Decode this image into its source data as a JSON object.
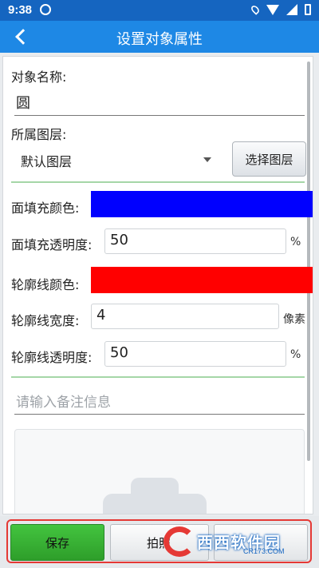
{
  "status_bar": {
    "time": "9:38"
  },
  "header": {
    "title": "设置对象属性"
  },
  "form": {
    "object_name_label": "对象名称:",
    "object_name_value": "圆",
    "layer_label": "所属图层:",
    "layer_value": "默认图层",
    "choose_layer_button": "选择图层",
    "fill_color_label": "面填充颜色:",
    "fill_color": "#0000ff",
    "fill_opacity_label": "面填充透明度:",
    "fill_opacity_value": "50",
    "fill_opacity_unit": "%",
    "outline_color_label": "轮廓线颜色:",
    "outline_color": "#ff0000",
    "outline_width_label": "轮廓线宽度:",
    "outline_width_value": "4",
    "outline_width_unit": "像素",
    "outline_opacity_label": "轮廓线透明度:",
    "outline_opacity_value": "50",
    "outline_opacity_unit": "%",
    "note_placeholder": "请输入备注信息"
  },
  "bottom_bar": {
    "save_label": "保存",
    "photo_label": "拍照",
    "watermark_text": "西西软件园",
    "watermark_sub": "CR173.COM"
  },
  "colors": {
    "primary": "#1e88e5",
    "save_green": "#3cb53a",
    "divider_green": "#a5d6a7"
  }
}
